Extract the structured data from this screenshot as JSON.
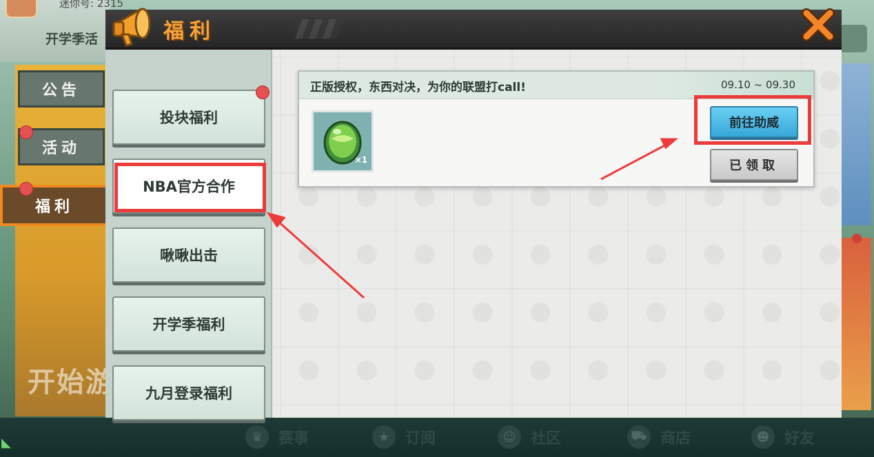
{
  "background": {
    "player_id": "迷你号: 2315",
    "event_title": "开学季活",
    "banner_text": "开始游",
    "side_tabs": [
      {
        "label": "公告",
        "badge": false
      },
      {
        "label": "活动",
        "badge": true
      },
      {
        "label": "福利",
        "badge": true,
        "active": true
      }
    ],
    "bottom_nav": [
      {
        "label": "赛事",
        "icon": "trophy-icon"
      },
      {
        "label": "订阅",
        "icon": "star-icon"
      },
      {
        "label": "社区",
        "icon": "community-icon"
      },
      {
        "label": "商店",
        "icon": "cart-icon"
      },
      {
        "label": "好友",
        "icon": "friend-icon"
      }
    ]
  },
  "modal": {
    "title": "福利",
    "close_icon": "close-icon",
    "menu": [
      {
        "label": "投块福利",
        "badge": true
      },
      {
        "label": "NBA官方合作",
        "badge": false,
        "selected": true
      },
      {
        "label": "啾啾出击",
        "badge": false
      },
      {
        "label": "开学季福利",
        "badge": false
      },
      {
        "label": "九月登录福利",
        "badge": false
      }
    ],
    "card": {
      "title": "正版授权，东西对决，为你的联盟打call!",
      "date_range": "09.10 ~ 09.30",
      "item_icon": "egg-icon",
      "item_count": "×1",
      "go_button": "前往助威",
      "claim_button": "已领取"
    }
  },
  "colors": {
    "accent_orange": "#f08a1e",
    "title_orange": "#f5a33a",
    "highlight_red": "#ec3b3b",
    "go_button_blue": "#38a7da",
    "badge_red": "#e65050"
  }
}
